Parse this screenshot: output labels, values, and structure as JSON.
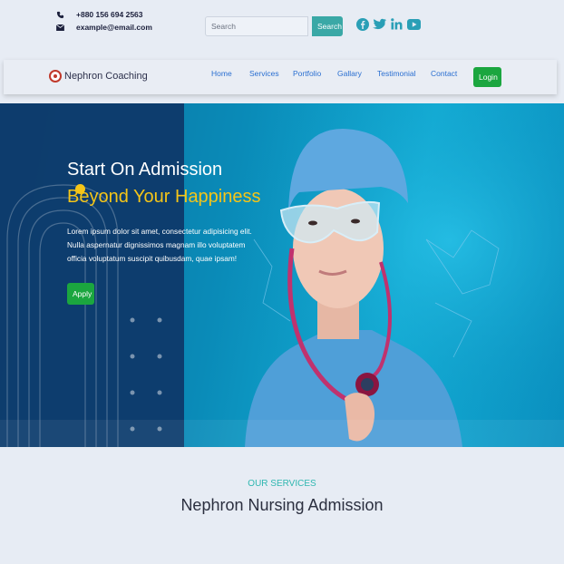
{
  "contact": {
    "phone": "+880 156 694 2563",
    "email": "example@email.com"
  },
  "search": {
    "placeholder": "Search",
    "button_label": "Search"
  },
  "socials": [
    "facebook-icon",
    "twitter-icon",
    "linkedin-icon",
    "youtube-icon"
  ],
  "brand": {
    "name": "Nephron Coaching"
  },
  "nav": {
    "items": [
      "Home",
      "Services",
      "Portfolio",
      "Gallary",
      "Testimonial",
      "Contact"
    ],
    "login_label": "Login"
  },
  "hero": {
    "title_line1": "Start On Admission",
    "title_line2": "Beyond Your Happiness",
    "description": "Lorem ipsum dolor sit amet, consectetur adipisicing elit. Nulla aspernatur dignissimos magnam illo voluptatem officia voluptatum suscipit quibusdam, quae ipsam!",
    "apply_label": "Apply"
  },
  "services": {
    "subtitle": "OUR SERVICES",
    "title": "Nephron Nursing Admission"
  },
  "colors": {
    "accent": "#3aa8a6",
    "primary_link": "#2a6fd1",
    "cta_green": "#1ba63f",
    "highlight_yellow": "#f5c518",
    "hero_dark": "#0e3a6b"
  }
}
